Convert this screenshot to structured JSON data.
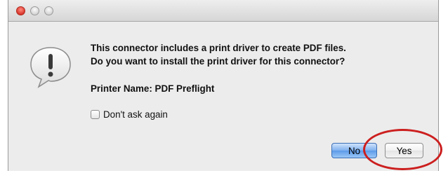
{
  "window": {
    "controls": [
      "close-button",
      "minimize-button",
      "zoom-button"
    ]
  },
  "dialog": {
    "icon": "alert-exclamation-icon",
    "message_line1": "This connector includes a print driver to create PDF files.",
    "message_line2": "Do you want to install the print driver for this connector?",
    "printer_name": "Printer Name: PDF Preflight",
    "checkbox_label": "Don't ask again",
    "checkbox_checked": false,
    "no_label": "No",
    "yes_label": "Yes"
  },
  "colors": {
    "default_button": "#6aa4ec",
    "highlight": "#cc1f1f"
  }
}
